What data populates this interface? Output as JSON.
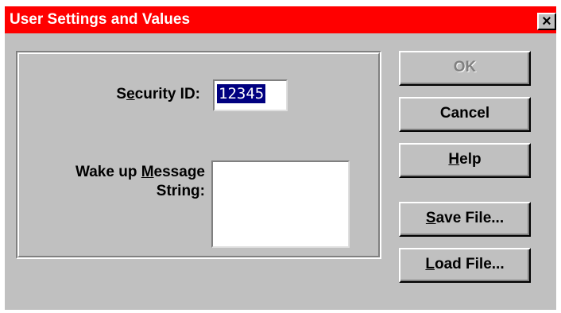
{
  "window": {
    "title": "User Settings and Values",
    "close_glyph": "×",
    "title_color": "#ff0000",
    "face_color": "#c0c0c0"
  },
  "form": {
    "security_label_pre": "S",
    "security_label_accel": "e",
    "security_label_post": "curity ID:",
    "security_value": "12345",
    "wake_label_line1_pre": "Wake up ",
    "wake_label_line1_accel": "M",
    "wake_label_line1_post": "essage",
    "wake_label_line2": "String:",
    "wake_value": ""
  },
  "buttons": {
    "ok": "OK",
    "cancel": "Cancel",
    "help_accel": "H",
    "help_rest": "elp",
    "save_accel": "S",
    "save_rest": "ave File...",
    "load_accel": "L",
    "load_rest": "oad File..."
  }
}
